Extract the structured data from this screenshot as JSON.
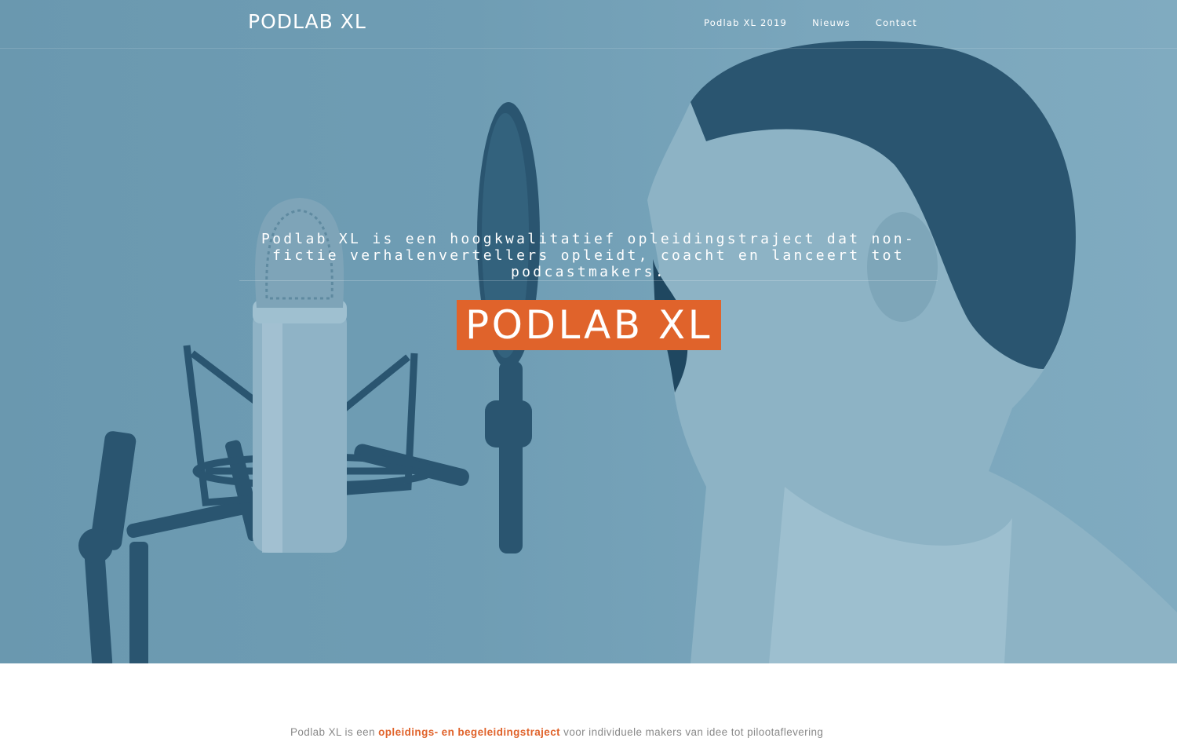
{
  "header": {
    "logo": "PODLAB XL",
    "nav": [
      {
        "label": "Podlab XL 2019"
      },
      {
        "label": "Nieuws"
      },
      {
        "label": "Contact"
      }
    ]
  },
  "hero": {
    "tagline": "Podlab XL is een hoogkwalitatief opleidingstraject dat non-fictie verhalenvertellers opleidt, coacht en lanceert tot podcastmakers.",
    "title": "PODLAB XL",
    "image": "boy-shouting-into-studio-microphone"
  },
  "intro": {
    "text_before": "Podlab XL is een ",
    "highlight": "opleidings- en begeleidingstraject",
    "text_after": " voor individuele makers van idee tot pilootaflevering"
  },
  "colors": {
    "accent": "#e0632b",
    "hero_tint": "#6f9db4",
    "hero_dark": "#2a5570",
    "body_text": "#8a8a8a"
  }
}
